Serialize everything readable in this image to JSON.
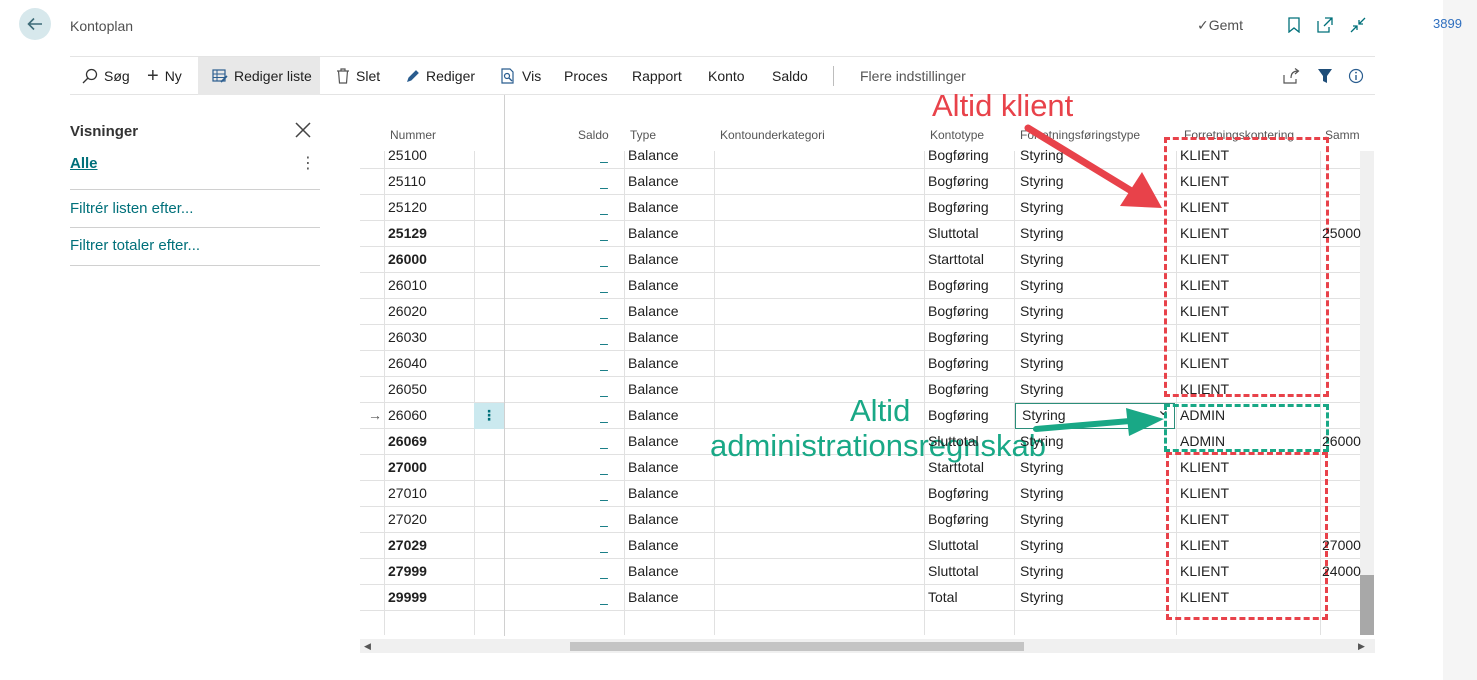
{
  "header": {
    "title": "Kontoplan",
    "saved_label": "Gemt",
    "side_number": "3899"
  },
  "actions": {
    "search": "Søg",
    "new": "Ny",
    "edit_list": "Rediger liste",
    "delete": "Slet",
    "edit": "Rediger",
    "view": "Vis",
    "process": "Proces",
    "report": "Rapport",
    "account": "Konto",
    "balance": "Saldo",
    "more": "Flere indstillinger"
  },
  "views": {
    "title": "Visninger",
    "all": "Alle",
    "filter_list": "Filtrér listen efter...",
    "filter_totals": "Filtrer totaler efter..."
  },
  "table": {
    "columns": {
      "number": "Nummer",
      "balance": "Saldo",
      "type": "Type",
      "subcategory": "Kontounderkategori",
      "account_type": "Kontotype",
      "business_type": "Forretningsføringstype",
      "business_posting": "Forretningskontering",
      "summation": "Sammen"
    },
    "rows": [
      {
        "number": "25100",
        "bold": false,
        "saldo": "_",
        "type": "Balance",
        "kontotype": "Bogføring",
        "business_type": "Styring",
        "posting": "KLIENT",
        "sum": ""
      },
      {
        "number": "25110",
        "bold": false,
        "saldo": "_",
        "type": "Balance",
        "kontotype": "Bogføring",
        "business_type": "Styring",
        "posting": "KLIENT",
        "sum": ""
      },
      {
        "number": "25120",
        "bold": false,
        "saldo": "_",
        "type": "Balance",
        "kontotype": "Bogføring",
        "business_type": "Styring",
        "posting": "KLIENT",
        "sum": ""
      },
      {
        "number": "25129",
        "bold": true,
        "saldo": "_",
        "type": "Balance",
        "kontotype": "Sluttotal",
        "business_type": "Styring",
        "posting": "KLIENT",
        "sum": "25000"
      },
      {
        "number": "26000",
        "bold": true,
        "saldo": "_",
        "type": "Balance",
        "kontotype": "Starttotal",
        "business_type": "Styring",
        "posting": "KLIENT",
        "sum": ""
      },
      {
        "number": "26010",
        "bold": false,
        "saldo": "_",
        "type": "Balance",
        "kontotype": "Bogføring",
        "business_type": "Styring",
        "posting": "KLIENT",
        "sum": ""
      },
      {
        "number": "26020",
        "bold": false,
        "saldo": "_",
        "type": "Balance",
        "kontotype": "Bogføring",
        "business_type": "Styring",
        "posting": "KLIENT",
        "sum": ""
      },
      {
        "number": "26030",
        "bold": false,
        "saldo": "_",
        "type": "Balance",
        "kontotype": "Bogføring",
        "business_type": "Styring",
        "posting": "KLIENT",
        "sum": ""
      },
      {
        "number": "26040",
        "bold": false,
        "saldo": "_",
        "type": "Balance",
        "kontotype": "Bogføring",
        "business_type": "Styring",
        "posting": "KLIENT",
        "sum": ""
      },
      {
        "number": "26050",
        "bold": false,
        "saldo": "_",
        "type": "Balance",
        "kontotype": "Bogføring",
        "business_type": "Styring",
        "posting": "KLIENT",
        "sum": ""
      },
      {
        "number": "26060",
        "bold": false,
        "saldo": "_",
        "type": "Balance",
        "kontotype": "Bogføring",
        "business_type": "Styring",
        "posting": "ADMIN",
        "sum": "",
        "selected": true
      },
      {
        "number": "26069",
        "bold": true,
        "saldo": "_",
        "type": "Balance",
        "kontotype": "Sluttotal",
        "business_type": "Styring",
        "posting": "ADMIN",
        "sum": "26000"
      },
      {
        "number": "27000",
        "bold": true,
        "saldo": "_",
        "type": "Balance",
        "kontotype": "Starttotal",
        "business_type": "Styring",
        "posting": "KLIENT",
        "sum": ""
      },
      {
        "number": "27010",
        "bold": false,
        "saldo": "_",
        "type": "Balance",
        "kontotype": "Bogføring",
        "business_type": "Styring",
        "posting": "KLIENT",
        "sum": ""
      },
      {
        "number": "27020",
        "bold": false,
        "saldo": "_",
        "type": "Balance",
        "kontotype": "Bogføring",
        "business_type": "Styring",
        "posting": "KLIENT",
        "sum": ""
      },
      {
        "number": "27029",
        "bold": true,
        "saldo": "_",
        "type": "Balance",
        "kontotype": "Sluttotal",
        "business_type": "Styring",
        "posting": "KLIENT",
        "sum": "27000"
      },
      {
        "number": "27999",
        "bold": true,
        "saldo": "_",
        "type": "Balance",
        "kontotype": "Sluttotal",
        "business_type": "Styring",
        "posting": "KLIENT",
        "sum": "24000"
      },
      {
        "number": "29999",
        "bold": true,
        "saldo": "_",
        "type": "Balance",
        "kontotype": "Total",
        "business_type": "Styring",
        "posting": "KLIENT",
        "sum": ""
      }
    ]
  },
  "annotations": {
    "always_client": "Altid klient",
    "always_admin_line1": "Altid",
    "always_admin_line2": "administrationsregnskab"
  },
  "colors": {
    "accent": "#00707a",
    "annotation_red": "#e8424a",
    "annotation_green": "#19a886"
  }
}
